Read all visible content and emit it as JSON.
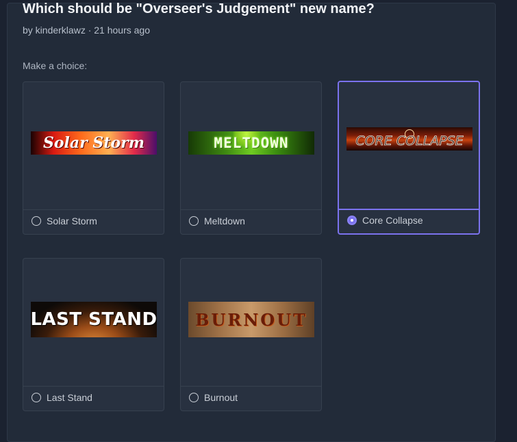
{
  "poll": {
    "title": "Which should be \"Overseer's Judgement\" new name?",
    "meta": "by kinderklawz · 21 hours ago",
    "prompt": "Make a choice:"
  },
  "options": [
    {
      "label": "Solar Storm",
      "banner_text": "Solar Storm",
      "selected": false
    },
    {
      "label": "Meltdown",
      "banner_text": "MELTDOWN",
      "selected": false
    },
    {
      "label": "Core Collapse",
      "banner_text": "CORE COLLAPSE",
      "selected": true
    },
    {
      "label": "Last Stand",
      "banner_text": "LAST STAND",
      "selected": false
    },
    {
      "label": "Burnout",
      "banner_text": "BURNOUT",
      "selected": false
    }
  ],
  "colors": {
    "accent": "#7b72ee",
    "card_bg": "#283140",
    "panel_bg": "#222b39"
  }
}
